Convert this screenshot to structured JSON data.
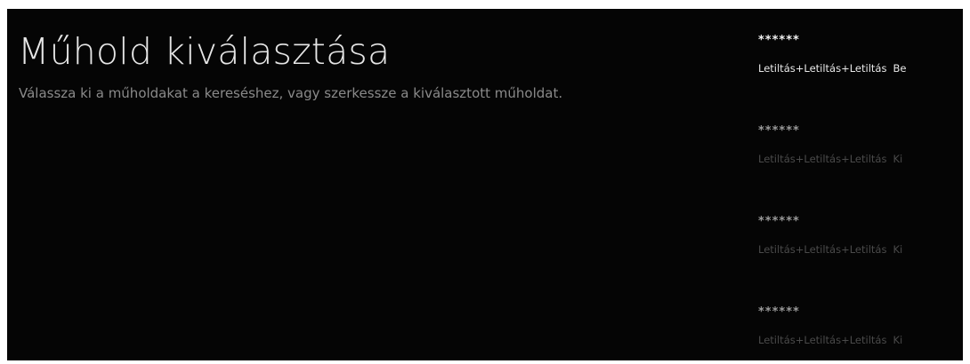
{
  "page": {
    "title": "Műhold kiválasztása",
    "subtitle": "Válassza ki a műholdakat a kereséshez, vagy szerkessze a kiválasztott műholdat."
  },
  "satellites": [
    {
      "name": "******",
      "config": "Letiltás+Letiltás+Letiltás",
      "state": "Be",
      "focused": true
    },
    {
      "name": "******",
      "config": "Letiltás+Letiltás+Letiltás",
      "state": "Ki",
      "focused": false
    },
    {
      "name": "******",
      "config": "Letiltás+Letiltás+Letiltás",
      "state": "Ki",
      "focused": false
    },
    {
      "name": "******",
      "config": "Letiltás+Letiltás+Letiltás",
      "state": "Ki",
      "focused": false
    }
  ],
  "colors": {
    "background": "#050505",
    "text_primary": "#e6e6e6",
    "text_secondary": "#8a8a8a",
    "text_dim": "#4a4a4a"
  }
}
